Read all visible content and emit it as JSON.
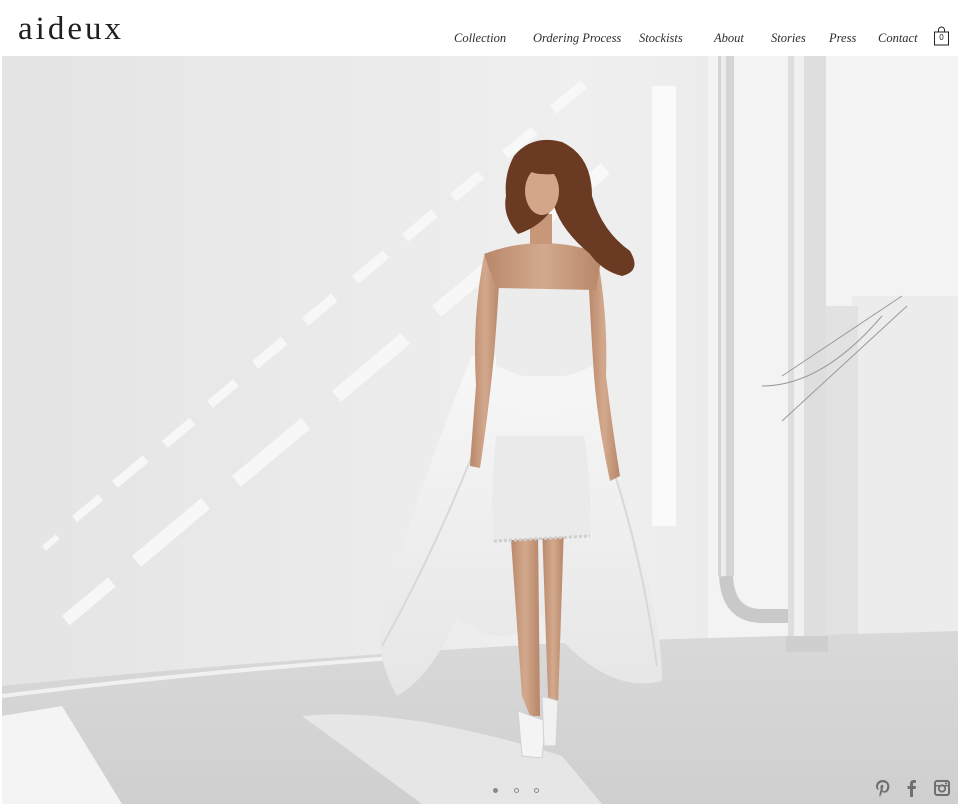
{
  "brand": {
    "logo_text": "aideux"
  },
  "nav": {
    "items": [
      {
        "label": "Collection"
      },
      {
        "label": "Ordering Process"
      },
      {
        "label": "Stockists"
      },
      {
        "label": "About"
      },
      {
        "label": "Stories"
      },
      {
        "label": "Press"
      },
      {
        "label": "Contact"
      }
    ]
  },
  "cart": {
    "count": "0",
    "icon": "shopping-bag-icon"
  },
  "hero": {
    "image": "model-in-white-strapless-dress-walking",
    "slides_total": 3,
    "active_slide": 1
  },
  "social": {
    "icons": [
      "pinterest-icon",
      "facebook-icon",
      "instagram-icon"
    ]
  },
  "colors": {
    "background": "#ffffff",
    "text": "#2b2b2b",
    "wall": "#e9e9e9",
    "floor": "#dcdcdc",
    "skin": "#c79a7d",
    "hair": "#6b3a22"
  }
}
